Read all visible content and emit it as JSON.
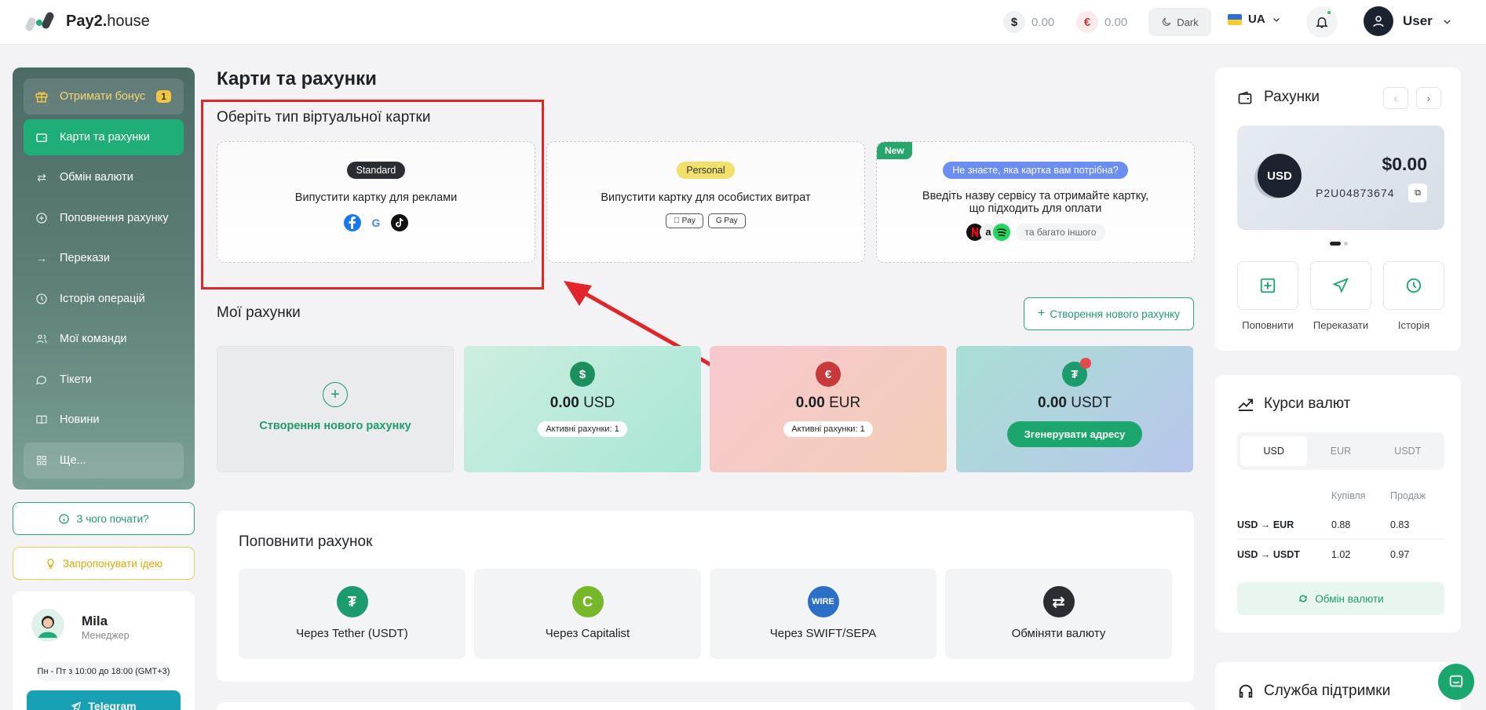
{
  "header": {
    "logo_bold": "Pay2.",
    "logo_light": "house",
    "balance_usd_symbol": "$",
    "balance_usd": "0.00",
    "balance_eur_symbol": "€",
    "balance_eur": "0.00",
    "theme_label": "Dark",
    "language": "UA",
    "user_name": "User"
  },
  "sidebar": {
    "items": [
      {
        "label": "Отримати бонус",
        "badge": "1"
      },
      {
        "label": "Карти та рахунки"
      },
      {
        "label": "Обмін валюти"
      },
      {
        "label": "Поповнення рахунку"
      },
      {
        "label": "Перекази"
      },
      {
        "label": "Історія операцій"
      },
      {
        "label": "Мої команди"
      },
      {
        "label": "Тікети"
      },
      {
        "label": "Новини"
      },
      {
        "label": "Ще..."
      }
    ],
    "start_label": "З чого почати?",
    "idea_label": "Запропонувати ідею",
    "manager": {
      "name": "Mila",
      "role": "Менеджер",
      "hours": "Пн - Пт з 10:00 до 18:00 (GMT+3)",
      "telegram_label": "Telegram"
    }
  },
  "main": {
    "page_title": "Карти та рахунки",
    "virtual_title": "Оберіть тип віртуальної картки",
    "cards": [
      {
        "pill": "Standard",
        "text": "Випустити картку для реклами"
      },
      {
        "pill": "Personal",
        "text": "Випустити картку для особистих витрат",
        "pay1": "Pay",
        "pay2": "G Pay"
      },
      {
        "new_tag": "New",
        "pill": "Не знаєте, яка картка вам потрібна?",
        "text": "Введіть назву сервісу та отримайте картку, що підходить для оплати",
        "more": "та багато іншого"
      }
    ],
    "accounts_title": "Мої рахунки",
    "create_account_label": "Створення нового рахунку",
    "accounts": [
      {
        "create_label": "Створення нового рахунку"
      },
      {
        "symbol": "$",
        "amount": "0.00",
        "currency": "USD",
        "active": "Активні рахунки: 1"
      },
      {
        "symbol": "€",
        "amount": "0.00",
        "currency": "EUR",
        "active": "Активні рахунки: 1"
      },
      {
        "symbol": "₮",
        "amount": "0.00",
        "currency": "USDT",
        "generate": "Згенерувати адресу"
      }
    ],
    "topup_title": "Поповнити рахунок",
    "topup_items": [
      {
        "label": "Через Tether (USDT)",
        "icon": "₮"
      },
      {
        "label": "Через Capitalist",
        "icon": "C"
      },
      {
        "label": "Через SWIFT/SEPA",
        "icon": "WIRE"
      },
      {
        "label": "Обміняти валюту",
        "icon": "⇄"
      }
    ]
  },
  "right": {
    "accounts_title": "Рахунки",
    "usd_code": "USD",
    "usd_amount": "$0.00",
    "usd_id": "P2U04873674",
    "actions": [
      {
        "label": "Поповнити"
      },
      {
        "label": "Переказати"
      },
      {
        "label": "Історія"
      }
    ],
    "rates_title": "Курси валют",
    "tabs": [
      "USD",
      "EUR",
      "USDT"
    ],
    "buy_label": "Купівля",
    "sell_label": "Продаж",
    "rates": [
      {
        "pair": "USD → EUR",
        "buy": "0.88",
        "sell": "0.83"
      },
      {
        "pair": "USD → USDT",
        "buy": "1.02",
        "sell": "0.97"
      }
    ],
    "exchange_label": "Обмін валюти",
    "support_title": "Служба підтримки"
  },
  "colors": {
    "accent_green": "#1fae78",
    "annotation_red": "#e0262a"
  }
}
